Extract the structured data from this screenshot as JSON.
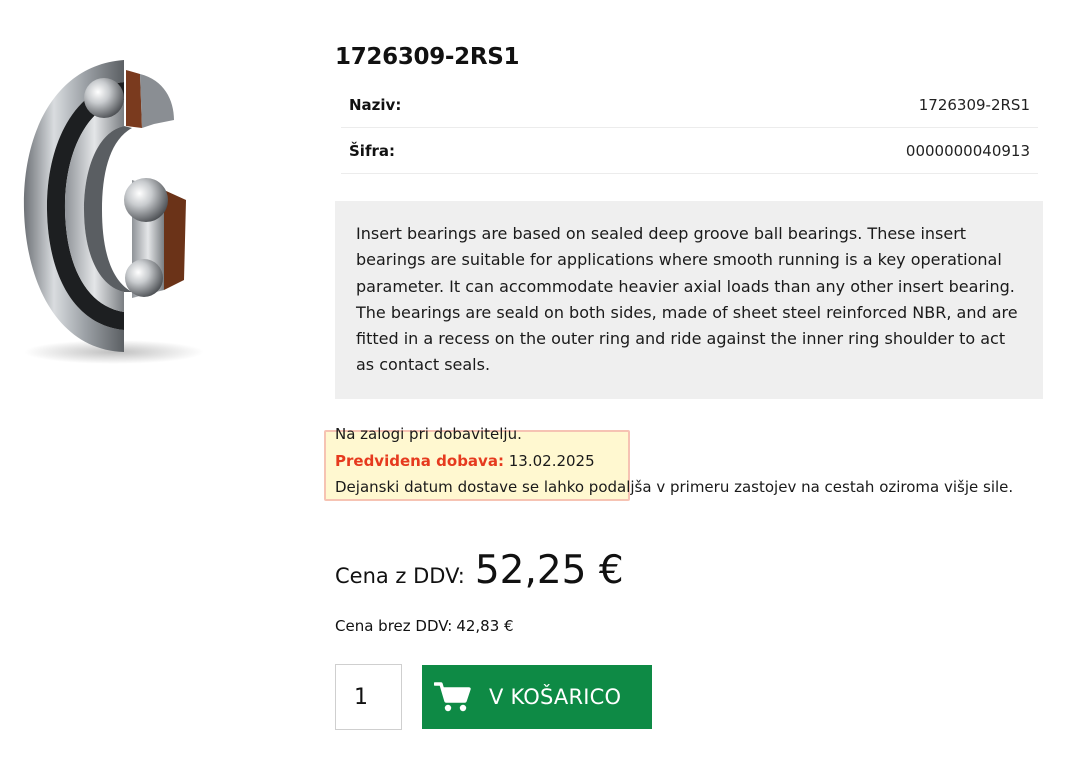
{
  "product": {
    "title": "1726309-2RS1",
    "image_name": "bearing-image"
  },
  "specs": [
    {
      "label": "Naziv:",
      "value": "1726309-2RS1"
    },
    {
      "label": "Šifra:",
      "value": "0000000040913"
    }
  ],
  "description": "Insert bearings are based on sealed deep groove ball bearings. These insert bearings are suitable for applications where smooth running is a key operational parameter. It can accommodate heavier axial loads than any other insert bearing. The bearings are seald on both sides, made of sheet steel reinforced NBR, and are fitted in a recess on the outer ring and ride against the inner ring shoulder to act as contact seals.",
  "stock": {
    "availability": "Na zalogi pri dobavitelju.",
    "supply_label": "Predvidena dobava:",
    "supply_date": "13.02.2025",
    "delay_note": "Dejanski datum dostave se lahko podaljša v primeru zastojev na cestah oziroma višje sile."
  },
  "price": {
    "gross_label": "Cena z DDV:",
    "gross_value": "52,25 €",
    "net_label": "Cena brez DDV:",
    "net_value": "42,83 €"
  },
  "cart": {
    "quantity": "1",
    "button_label": "V KOŠARICO",
    "icon": "cart-icon"
  },
  "colors": {
    "accent_green": "#0e8a45",
    "supply_red": "#e63a1e",
    "desc_bg": "#efefef"
  }
}
